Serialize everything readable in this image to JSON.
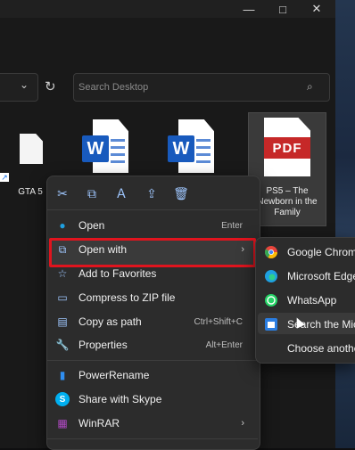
{
  "window": {
    "minimize_glyph": "—",
    "maximize_glyph": "□",
    "close_glyph": "✕"
  },
  "address": {
    "chevron_glyph": "⌄",
    "refresh_glyph": "↻"
  },
  "search": {
    "placeholder": "Search Desktop",
    "icon_glyph": "⌕"
  },
  "files": [
    {
      "label": "GTA 5"
    },
    {
      "label": ""
    },
    {
      "label": ""
    },
    {
      "label": "PS5 – The Newborn in the Family"
    }
  ],
  "file_icons": {
    "word_letter": "W",
    "pdf_label": "PDF",
    "shortcut_glyph": "↗"
  },
  "quick_actions": [
    {
      "name": "cut-icon",
      "glyph": "✂"
    },
    {
      "name": "copy-icon",
      "glyph": "⧉"
    },
    {
      "name": "rename-icon",
      "glyph": "Ａ"
    },
    {
      "name": "share-icon",
      "glyph": "⇪"
    },
    {
      "name": "delete-icon",
      "glyph": "🗑"
    }
  ],
  "context_menu": {
    "items": [
      {
        "label": "Open",
        "shortcut": "Enter",
        "icon": "edge-icon",
        "glyph": "●"
      },
      {
        "label": "Open with",
        "shortcut": "",
        "icon": "open-with-icon",
        "glyph": "⧉",
        "arrow": "›"
      },
      {
        "label": "Add to Favorites",
        "shortcut": "",
        "icon": "star-icon",
        "glyph": "☆"
      },
      {
        "label": "Compress to ZIP file",
        "shortcut": "",
        "icon": "zip-icon",
        "glyph": "▭"
      },
      {
        "label": "Copy as path",
        "shortcut": "Ctrl+Shift+C",
        "icon": "copy-path-icon",
        "glyph": "▤"
      },
      {
        "label": "Properties",
        "shortcut": "Alt+Enter",
        "icon": "wrench-icon",
        "glyph": "🔧"
      },
      {
        "label": "PowerRename",
        "shortcut": "",
        "icon": "powerrename-icon",
        "glyph": "▮"
      },
      {
        "label": "Share with Skype",
        "shortcut": "",
        "icon": "skype-icon",
        "glyph": "S"
      },
      {
        "label": "WinRAR",
        "shortcut": "",
        "icon": "winrar-icon",
        "glyph": "▦",
        "arrow": "›"
      }
    ]
  },
  "open_with_submenu": {
    "items": [
      {
        "label": "Google Chrome",
        "icon": "chrome-icon",
        "color": "#e8453c"
      },
      {
        "label": "Microsoft Edge",
        "icon": "edge-icon",
        "color": "#1fa0e0"
      },
      {
        "label": "WhatsApp",
        "icon": "whatsapp-icon",
        "color": "#25d366"
      },
      {
        "label": "Search the Microsoft Store",
        "icon": "store-icon",
        "color": "#2a7de1"
      },
      {
        "label": "Choose another app",
        "icon": "",
        "color": ""
      }
    ]
  },
  "colors": {
    "highlight_border": "#e0141e",
    "word_blue": "#185abd",
    "pdf_red": "#c62828"
  }
}
